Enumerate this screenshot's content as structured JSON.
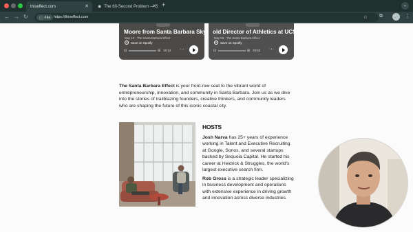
{
  "browser": {
    "tabs": [
      {
        "title": "thiseffect.com",
        "active": true
      },
      {
        "title": "The 60-Second Problem — S",
        "active": false
      }
    ],
    "new_tab_label": "+",
    "tab_menu_label": "⌄",
    "address": {
      "chip": "File",
      "url": "https://thiseffect.com"
    }
  },
  "episodes": [
    {
      "title": "Moore from Santa Barbara Sky",
      "subtitle": "May 13 · The Santa Barbara Effect",
      "save_label": "Save on Spotify",
      "time": "19:14",
      "progress": 0.0
    },
    {
      "title": "old Director of Athletics at UCSB",
      "subtitle": "May 09 · The Santa Barbara Effect",
      "save_label": "Save on Spotify",
      "time": "29:53",
      "progress": 0.0
    }
  ],
  "intro": {
    "brand": "The Santa Barbara Effect",
    "text": " is your front-row seat to the vibrant world of entrepreneurship, innovation, and community in Santa Barbara. Join us as we dive into the stories of trailblazing founders, creative thinkers, and community leaders who are shaping the future of this iconic coastal city."
  },
  "hosts": {
    "heading": "HOSTS",
    "host1_name": "Josh Narva",
    "host1_bio": " has 25+ years of experience working in Talent and Executive Recruiting at Google, Sonos, and several startups backed by Sequoia Capital. He started his career at Heidrick & Struggles, the world's largest executive search firm.",
    "host2_name": "Rob Gross",
    "host2_bio": " is a strategic leader specializing in business development and operations with extensive experience in driving growth and innovation across diverse industries."
  },
  "colors": {
    "card_bg": "#4c4a48",
    "page_bg": "#fbfbfc",
    "chrome_bg": "#2f4241"
  }
}
